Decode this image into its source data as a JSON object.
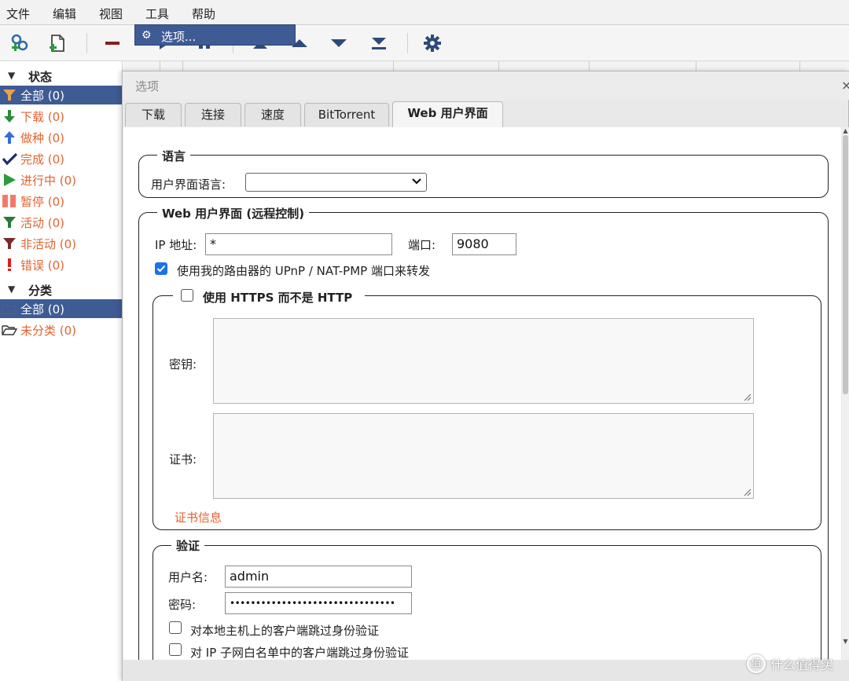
{
  "menubar": {
    "items": [
      "文件",
      "编辑",
      "视图",
      "工具",
      "帮助"
    ]
  },
  "toolbar": {
    "buttons": [
      "add-torrent-link-icon",
      "add-torrent-file-icon",
      "remove-icon",
      "resume-icon",
      "pause-icon",
      "move-top-icon",
      "move-up-icon",
      "move-down-icon",
      "move-bottom-icon",
      "options-gear-icon"
    ]
  },
  "tools_menu": {
    "options_label": "选项..."
  },
  "sidebar": {
    "status_header": "状态",
    "status_items": [
      {
        "label": "全部 (0)",
        "icon": "filter-all-icon"
      },
      {
        "label": "下载 (0)",
        "icon": "download-arrow-icon"
      },
      {
        "label": "做种 (0)",
        "icon": "seeding-arrow-icon"
      },
      {
        "label": "完成 (0)",
        "icon": "checkmark-icon"
      },
      {
        "label": "进行中 (0)",
        "icon": "play-icon"
      },
      {
        "label": "暂停 (0)",
        "icon": "pause-icon"
      },
      {
        "label": "活动 (0)",
        "icon": "active-filter-icon"
      },
      {
        "label": "非活动 (0)",
        "icon": "inactive-filter-icon"
      },
      {
        "label": "错误 (0)",
        "icon": "error-icon"
      }
    ],
    "category_header": "分类",
    "category_items": [
      {
        "label": "全部 (0)",
        "icon": "folder-icon"
      },
      {
        "label": "未分类 (0)",
        "icon": "open-folder-icon"
      }
    ]
  },
  "dialog": {
    "title": "选项",
    "close": "×",
    "tabs": [
      "下载",
      "连接",
      "速度",
      "BitTorrent",
      "Web 用户界面"
    ],
    "active_tab": "Web 用户界面",
    "language": {
      "legend": "语言",
      "ui_language_label": "用户界面语言:",
      "ui_language_value": ""
    },
    "webui": {
      "legend": "Web 用户界面 (远程控制)",
      "ip_label": "IP 地址:",
      "ip_value": "*",
      "port_label": "端口:",
      "port_value": "9080",
      "upnp_label": "使用我的路由器的 UPnP / NAT-PMP 端口来转发",
      "upnp_checked": true
    },
    "https": {
      "legend": "使用 HTTPS 而不是 HTTP",
      "checked": false,
      "key_label": "密钥:",
      "cert_label": "证书:",
      "cert_info_link": "证书信息"
    },
    "auth": {
      "legend": "验证",
      "username_label": "用户名:",
      "username_value": "admin",
      "password_label": "密码:",
      "password_value": "••••••••••••••••••••••••••••••••",
      "bypass_localhost_label": "对本地主机上的客户端跳过身份验证",
      "bypass_whitelist_label": "对 IP 子网白名单中的客户端跳过身份验证"
    }
  },
  "watermark": {
    "logo": "值",
    "text": "什么值得买"
  },
  "colors": {
    "selection": "#3e5b94",
    "accent_orange": "#e4622e",
    "checkbox_blue": "#1a73e8"
  }
}
